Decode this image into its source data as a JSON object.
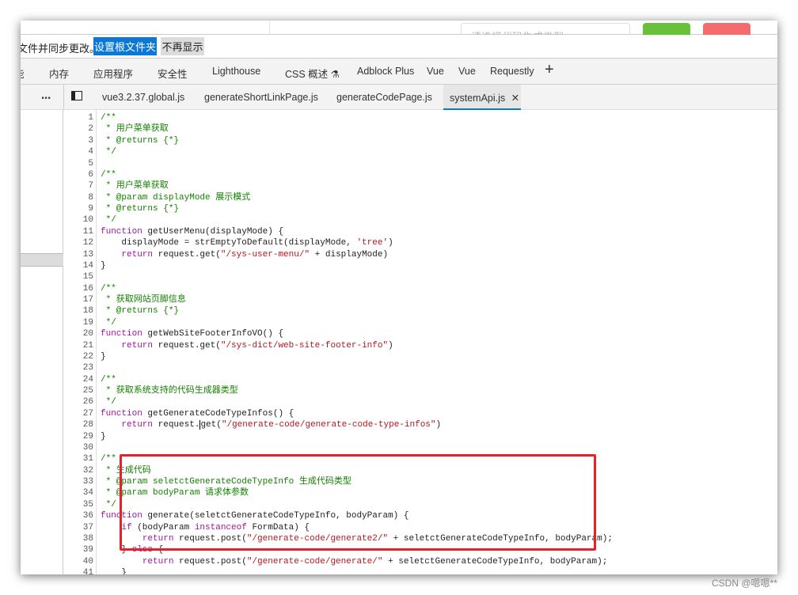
{
  "behind": {
    "select_placeholder": "请选择代码生成类型",
    "accent_green": "#67c23a",
    "accent_red": "#f56c6c"
  },
  "infobar": {
    "message": "文件并同步更改。",
    "set_root_button": "设置根文件夹",
    "dont_show_button": "不再显示"
  },
  "panel_tabs": [
    "能",
    "内存",
    "应用程序",
    "安全性",
    "Lighthouse",
    "CSS 概述 ⚗",
    "Adblock Plus",
    "Vue",
    "Vue",
    "Requestly",
    "+"
  ],
  "file_tabs": {
    "more": "⋯",
    "tabs": [
      "vue3.2.37.global.js",
      "generateShortLinkPage.js",
      "generateCodePage.js",
      "systemApi.js"
    ],
    "active": "systemApi.js",
    "close": "✕"
  },
  "code": [
    [
      [
        "c",
        "/**"
      ]
    ],
    [
      [
        "c",
        " * 用户菜单获取"
      ]
    ],
    [
      [
        "c",
        " * @returns {*}"
      ]
    ],
    [
      [
        "c",
        " */"
      ]
    ],
    [],
    [
      [
        "c",
        "/**"
      ]
    ],
    [
      [
        "c",
        " * 用户菜单获取"
      ]
    ],
    [
      [
        "c",
        " * @param displayMode 展示模式"
      ]
    ],
    [
      [
        "c",
        " * @returns {*}"
      ]
    ],
    [
      [
        "c",
        " */"
      ]
    ],
    [
      [
        "k",
        "function"
      ],
      [
        "p",
        " getUserMenu(displayMode) {"
      ]
    ],
    [
      [
        "p",
        "    displayMode = strEmptyToDefault(displayMode, "
      ],
      [
        "s",
        "'tree'"
      ],
      [
        "p",
        ")"
      ]
    ],
    [
      [
        "p",
        "    "
      ],
      [
        "k",
        "return"
      ],
      [
        "p",
        " request.get("
      ],
      [
        "s",
        "\"/sys-user-menu/\""
      ],
      [
        "p",
        " + displayMode)"
      ]
    ],
    [
      [
        "p",
        "}"
      ]
    ],
    [],
    [
      [
        "c",
        "/**"
      ]
    ],
    [
      [
        "c",
        " * 获取网站页脚信息"
      ]
    ],
    [
      [
        "c",
        " * @returns {*}"
      ]
    ],
    [
      [
        "c",
        " */"
      ]
    ],
    [
      [
        "k",
        "function"
      ],
      [
        "p",
        " getWebSiteFooterInfoVO() {"
      ]
    ],
    [
      [
        "p",
        "    "
      ],
      [
        "k",
        "return"
      ],
      [
        "p",
        " request.get("
      ],
      [
        "s",
        "\"/sys-dict/web-site-footer-info\""
      ],
      [
        "p",
        ")"
      ]
    ],
    [
      [
        "p",
        "}"
      ]
    ],
    [],
    [
      [
        "c",
        "/**"
      ]
    ],
    [
      [
        "c",
        " * 获取系统支持的代码生成器类型"
      ]
    ],
    [
      [
        "c",
        " */"
      ]
    ],
    [
      [
        "k",
        "function"
      ],
      [
        "p",
        " getGenerateCodeTypeInfos() {"
      ]
    ],
    [
      [
        "p",
        "    "
      ],
      [
        "k",
        "return"
      ],
      [
        "p",
        " request."
      ],
      [
        "caret",
        "g"
      ],
      [
        "p",
        "et("
      ],
      [
        "s",
        "\"/generate-code/generate-code-type-infos\""
      ],
      [
        "p",
        ")"
      ]
    ],
    [
      [
        "p",
        "}"
      ]
    ],
    [],
    [
      [
        "c",
        "/**"
      ]
    ],
    [
      [
        "c",
        " * 生成代码"
      ]
    ],
    [
      [
        "c",
        " * @param seletctGenerateCodeTypeInfo 生成代码类型"
      ]
    ],
    [
      [
        "c",
        " * @param bodyParam 请求体参数"
      ]
    ],
    [
      [
        "c",
        " */"
      ]
    ],
    [
      [
        "k",
        "function"
      ],
      [
        "p",
        " generate(seletctGenerateCodeTypeInfo, bodyParam) {"
      ]
    ],
    [
      [
        "p",
        "    "
      ],
      [
        "k",
        "if"
      ],
      [
        "p",
        " (bodyParam "
      ],
      [
        "k",
        "instanceof"
      ],
      [
        "p",
        " FormData) {"
      ]
    ],
    [
      [
        "p",
        "        "
      ],
      [
        "k",
        "return"
      ],
      [
        "p",
        " request.post("
      ],
      [
        "s",
        "\"/generate-code/generate2/\""
      ],
      [
        "p",
        " + seletctGenerateCodeTypeInfo, bodyParam);"
      ]
    ],
    [
      [
        "p",
        "    } "
      ],
      [
        "k",
        "else"
      ],
      [
        "p",
        " {"
      ]
    ],
    [
      [
        "p",
        "        "
      ],
      [
        "k",
        "return"
      ],
      [
        "p",
        " request.post("
      ],
      [
        "s",
        "\"/generate-code/generate/\""
      ],
      [
        "p",
        " + seletctGenerateCodeTypeInfo, bodyParam);"
      ]
    ],
    [
      [
        "p",
        "    }"
      ]
    ]
  ],
  "highlight_color": "#e8202a",
  "watermark": "CSDN @嗯嗯**"
}
